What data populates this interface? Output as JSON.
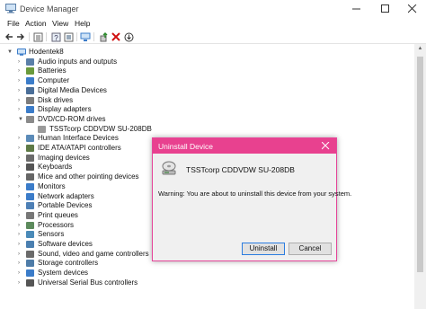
{
  "window": {
    "title": "Device Manager"
  },
  "menu": [
    "File",
    "Action",
    "View",
    "Help"
  ],
  "toolbar": [
    "back-icon",
    "forward-icon",
    "properties-icon",
    "help-icon",
    "show-hidden-icon",
    "monitor-icon",
    "update-driver-icon",
    "uninstall-icon",
    "scan-icon"
  ],
  "tree": {
    "root": "Hodentek8",
    "items": [
      {
        "label": "Audio inputs and outputs",
        "icon": "speaker-icon",
        "color": "#5a7fa8",
        "expanded": false
      },
      {
        "label": "Batteries",
        "icon": "battery-icon",
        "color": "#6a9a3c",
        "expanded": false
      },
      {
        "label": "Computer",
        "icon": "computer-icon",
        "color": "#3b7cc9",
        "expanded": false
      },
      {
        "label": "Digital Media Devices",
        "icon": "media-icon",
        "color": "#4a6e98",
        "expanded": false
      },
      {
        "label": "Disk drives",
        "icon": "disk-icon",
        "color": "#7c7c7c",
        "expanded": false
      },
      {
        "label": "Display adapters",
        "icon": "display-icon",
        "color": "#3b7cc9",
        "expanded": false
      },
      {
        "label": "DVD/CD-ROM drives",
        "icon": "dvd-icon",
        "color": "#8a8a8a",
        "expanded": true
      },
      {
        "label": "TSSTcorp CDDVDW SU-208DB",
        "icon": "dvd-drive-icon",
        "color": "#9a9a9a",
        "child": true
      },
      {
        "label": "Human Interface Devices",
        "icon": "hid-icon",
        "color": "#5b8bb8",
        "expanded": false
      },
      {
        "label": "IDE ATA/ATAPI controllers",
        "icon": "ide-icon",
        "color": "#5e7a46",
        "expanded": false
      },
      {
        "label": "Imaging devices",
        "icon": "camera-icon",
        "color": "#6b6b6b",
        "expanded": false
      },
      {
        "label": "Keyboards",
        "icon": "keyboard-icon",
        "color": "#555555",
        "expanded": false
      },
      {
        "label": "Mice and other pointing devices",
        "icon": "mouse-icon",
        "color": "#666666",
        "expanded": false
      },
      {
        "label": "Monitors",
        "icon": "monitor-icon",
        "color": "#3b7cc9",
        "expanded": false
      },
      {
        "label": "Network adapters",
        "icon": "network-icon",
        "color": "#3b7cc9",
        "expanded": false
      },
      {
        "label": "Portable Devices",
        "icon": "portable-icon",
        "color": "#4d7fb5",
        "expanded": false
      },
      {
        "label": "Print queues",
        "icon": "printer-icon",
        "color": "#777777",
        "expanded": false
      },
      {
        "label": "Processors",
        "icon": "processor-icon",
        "color": "#5c8a5c",
        "expanded": false
      },
      {
        "label": "Sensors",
        "icon": "sensor-icon",
        "color": "#4a8ab8",
        "expanded": false
      },
      {
        "label": "Software devices",
        "icon": "software-icon",
        "color": "#4a7fb0",
        "expanded": false
      },
      {
        "label": "Sound, video and game controllers",
        "icon": "sound-icon",
        "color": "#6a6a6a",
        "expanded": false
      },
      {
        "label": "Storage controllers",
        "icon": "storage-icon",
        "color": "#4e7ca8",
        "expanded": false
      },
      {
        "label": "System devices",
        "icon": "system-icon",
        "color": "#3b7cc9",
        "expanded": false
      },
      {
        "label": "Universal Serial Bus controllers",
        "icon": "usb-icon",
        "color": "#555555",
        "expanded": false
      }
    ]
  },
  "dialog": {
    "title": "Uninstall Device",
    "device_name": "TSSTcorp CDDVDW SU-208DB",
    "warning": "Warning: You are about to uninstall this device from your system.",
    "uninstall_label": "Uninstall",
    "cancel_label": "Cancel",
    "accent": "#e8418f"
  }
}
